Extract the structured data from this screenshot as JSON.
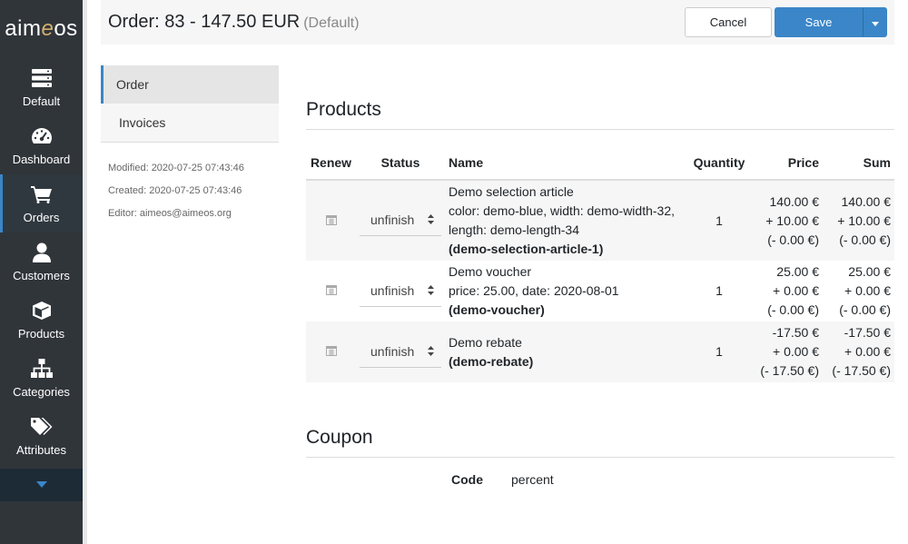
{
  "sidebar": {
    "logo": {
      "prefix": "aim",
      "accent": "e",
      "suffix": "os"
    },
    "items": [
      {
        "label": "Default",
        "icon": "server-icon"
      },
      {
        "label": "Dashboard",
        "icon": "gauge-icon"
      },
      {
        "label": "Orders",
        "icon": "cart-icon",
        "active": true
      },
      {
        "label": "Customers",
        "icon": "user-icon"
      },
      {
        "label": "Products",
        "icon": "cube-icon"
      },
      {
        "label": "Categories",
        "icon": "sitemap-icon"
      },
      {
        "label": "Attributes",
        "icon": "tags-icon"
      }
    ],
    "more_icon": "caret-down-icon"
  },
  "header": {
    "title": "Order: 83 - 147.50 EUR",
    "site": "(Default)",
    "cancel_label": "Cancel",
    "save_label": "Save"
  },
  "tabs": [
    {
      "label": "Order",
      "active": true
    },
    {
      "label": "Invoices"
    }
  ],
  "meta": {
    "modified": "Modified: 2020-07-25 07:43:46",
    "created": "Created: 2020-07-25 07:43:46",
    "editor": "Editor: aimeos@aimeos.org"
  },
  "products": {
    "heading": "Products",
    "columns": {
      "renew": "Renew",
      "status": "Status",
      "name": "Name",
      "quantity": "Quantity",
      "price": "Price",
      "sum": "Sum"
    },
    "rows": [
      {
        "status": "unfinish",
        "name": "Demo selection article",
        "details": [
          "color: demo-blue, width: demo-width-32,",
          "length: demo-length-34"
        ],
        "code": "(demo-selection-article-1)",
        "quantity": "1",
        "price": [
          "140.00 €",
          "+ 10.00 €",
          "(- 0.00 €)"
        ],
        "sum": [
          "140.00 €",
          "+ 10.00 €",
          "(- 0.00 €)"
        ]
      },
      {
        "status": "unfinish",
        "name": "Demo voucher",
        "details": [
          "price: 25.00, date: 2020-08-01"
        ],
        "code": "(demo-voucher)",
        "quantity": "1",
        "price": [
          "25.00 €",
          "+ 0.00 €",
          "(- 0.00 €)"
        ],
        "sum": [
          "25.00 €",
          "+ 0.00 €",
          "(- 0.00 €)"
        ]
      },
      {
        "status": "unfinish",
        "name": "Demo rebate",
        "details": [],
        "code": "(demo-rebate)",
        "quantity": "1",
        "price": [
          "-17.50 €",
          "+ 0.00 €",
          "(- 17.50 €)"
        ],
        "sum": [
          "-17.50 €",
          "+ 0.00 €",
          "(- 17.50 €)"
        ]
      }
    ]
  },
  "coupon": {
    "heading": "Coupon",
    "code_label": "Code",
    "code_value": "percent"
  },
  "colors": {
    "sidebar": "#30353a",
    "accent": "#3a86c8",
    "more_bar": "#1d2b37"
  }
}
